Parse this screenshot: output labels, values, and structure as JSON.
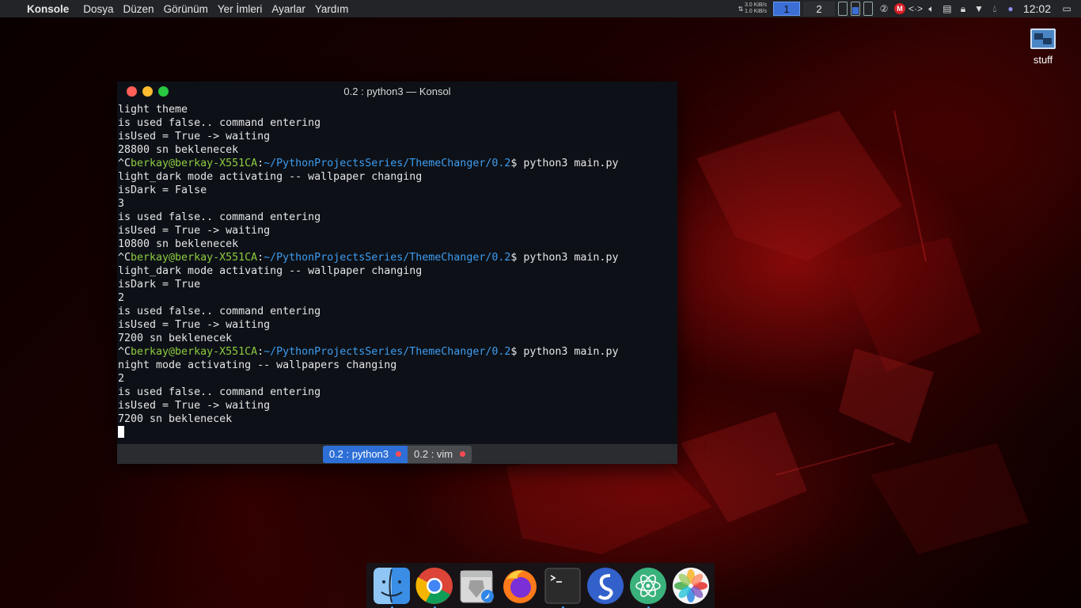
{
  "menubar": {
    "apple_glyph": "",
    "app_name": "Konsole",
    "menus": [
      "Dosya",
      "Düzen",
      "Görünüm",
      "Yer İmleri",
      "Ayarlar",
      "Yardım"
    ],
    "net_up": "3.0 KiB/s",
    "net_down": "1.0 KiB/s",
    "desktops": [
      "1",
      "2"
    ],
    "clock": "12:02",
    "badge_m": "M"
  },
  "desktop_icons": [
    {
      "label": "stuff"
    }
  ],
  "window": {
    "title": "0.2 : python3 — Konsol",
    "terminal_lines": [
      {
        "text": "light theme"
      },
      {
        "text": "is used false.. command entering"
      },
      {
        "text": "isUsed = True -> waiting"
      },
      {
        "text": "28800 sn beklenecek"
      },
      {
        "prompt": true,
        "prefix": "^C",
        "user": "berkay@berkay-X551CA",
        "sep": ":",
        "path": "~/PythonProjectsSeries/ThemeChanger/0.2",
        "cmd": "$ python3 main.py"
      },
      {
        "text": "light_dark mode activating -- wallpaper changing"
      },
      {
        "text": "isDark = False"
      },
      {
        "text": "3"
      },
      {
        "text": "is used false.. command entering"
      },
      {
        "text": "isUsed = True -> waiting"
      },
      {
        "text": "10800 sn beklenecek"
      },
      {
        "prompt": true,
        "prefix": "^C",
        "user": "berkay@berkay-X551CA",
        "sep": ":",
        "path": "~/PythonProjectsSeries/ThemeChanger/0.2",
        "cmd": "$ python3 main.py"
      },
      {
        "text": "light_dark mode activating -- wallpaper changing"
      },
      {
        "text": "isDark = True"
      },
      {
        "text": "2"
      },
      {
        "text": "is used false.. command entering"
      },
      {
        "text": "isUsed = True -> waiting"
      },
      {
        "text": "7200 sn beklenecek"
      },
      {
        "prompt": true,
        "prefix": "^C",
        "user": "berkay@berkay-X551CA",
        "sep": ":",
        "path": "~/PythonProjectsSeries/ThemeChanger/0.2",
        "cmd": "$ python3 main.py"
      },
      {
        "text": "night mode activating -- wallpapers changing"
      },
      {
        "text": "2"
      },
      {
        "text": "is used false.. command entering"
      },
      {
        "text": "isUsed = True -> waiting"
      },
      {
        "text": "7200 sn beklenecek"
      }
    ],
    "tabs": [
      {
        "label": "0.2 : python3",
        "active": true
      },
      {
        "label": "0.2 : vim",
        "active": false
      }
    ]
  },
  "dock": {
    "items": [
      {
        "icon": "finder-icon",
        "running": true
      },
      {
        "icon": "chrome-icon",
        "running": true
      },
      {
        "icon": "brave-icon",
        "running": false
      },
      {
        "icon": "firefox-icon",
        "running": false
      },
      {
        "icon": "terminal-icon",
        "running": true
      },
      {
        "icon": "simplenote-icon",
        "running": false
      },
      {
        "icon": "atom-icon",
        "running": true
      },
      {
        "icon": "photos-icon",
        "running": false
      }
    ]
  },
  "colors": {
    "user": "#8ecb3e",
    "path": "#3e9cf0",
    "tab_active": "#2d6fd6",
    "terminal_bg": "#0d1117"
  }
}
